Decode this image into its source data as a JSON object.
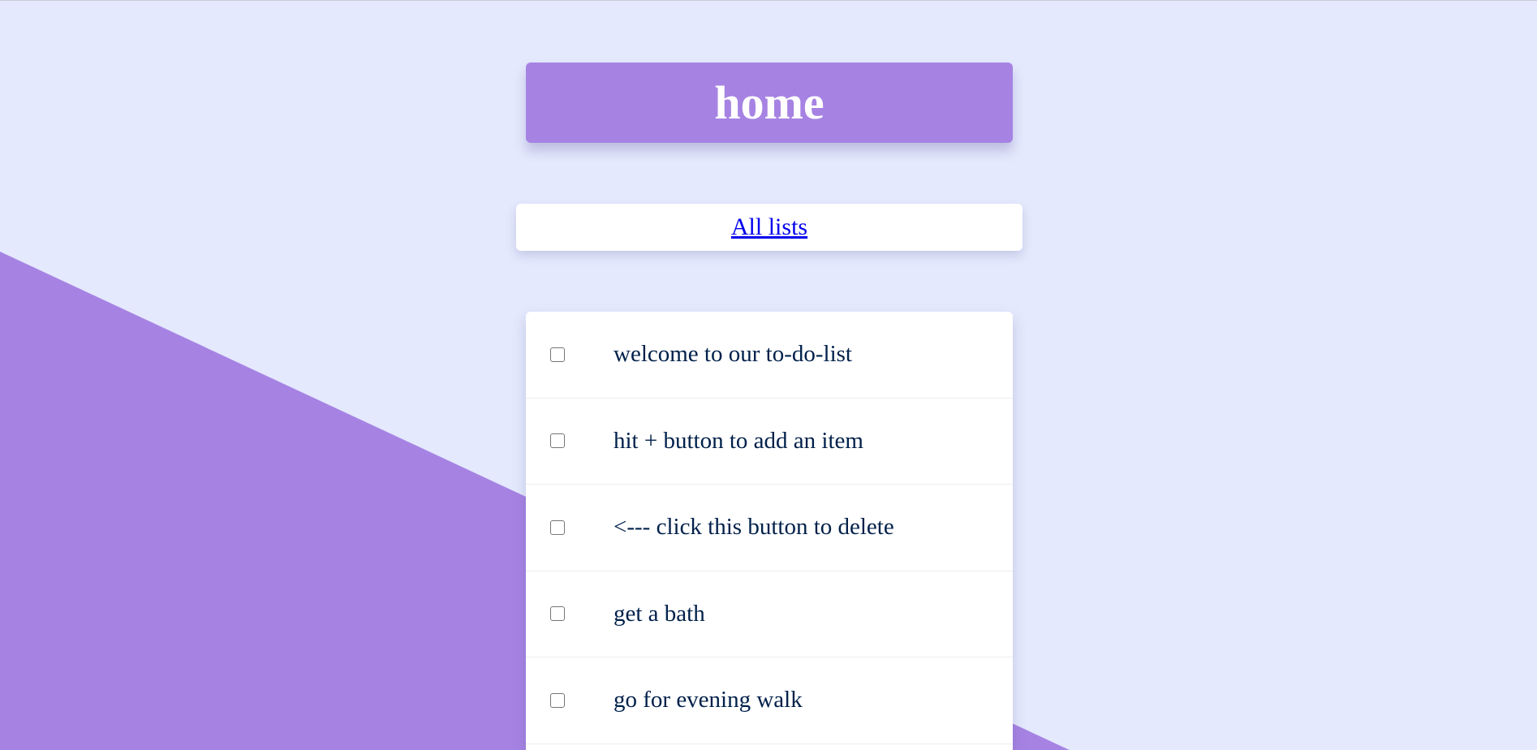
{
  "heading": {
    "title": "home"
  },
  "nav": {
    "all_lists_label": "All lists"
  },
  "list": {
    "items": [
      {
        "text": "welcome to our to-do-list",
        "checked": false
      },
      {
        "text": "hit + button to add an item",
        "checked": false
      },
      {
        "text": "<--- click this button to delete",
        "checked": false
      },
      {
        "text": "get a bath",
        "checked": false
      },
      {
        "text": "go for evening walk",
        "checked": false
      }
    ]
  },
  "colors": {
    "background": "#E4E9FD",
    "accent": "#A683E3",
    "card": "#FFFFFF",
    "item_text": "#00204A",
    "link": "#0000EE"
  }
}
